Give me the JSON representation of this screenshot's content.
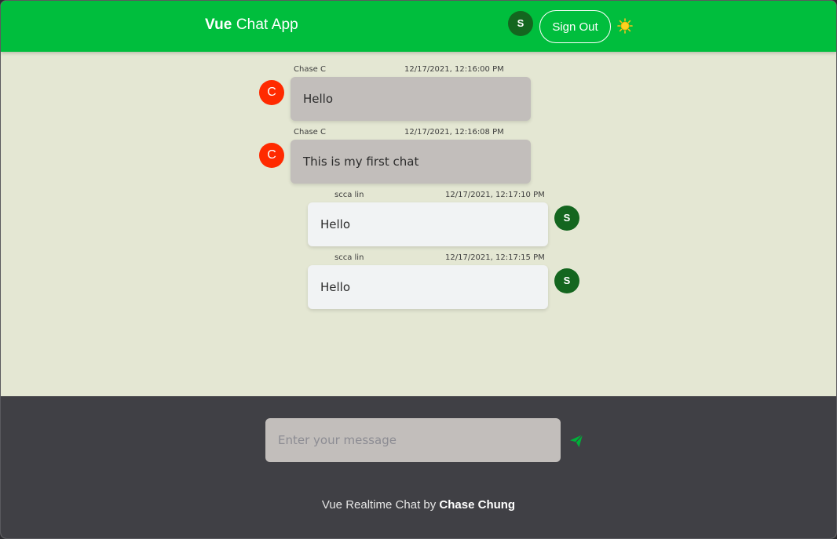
{
  "header": {
    "brand_strong": "Vue",
    "brand_rest": " Chat App",
    "avatar_initial": "S",
    "signout_label": "Sign Out",
    "theme_icon": "sun-icon",
    "accent_color": "#00be3d"
  },
  "messages": [
    {
      "name": "Chase C",
      "time": "12/17/2021, 12:16:00 PM",
      "text": "Hello",
      "initial": "C",
      "side": "other"
    },
    {
      "name": "Chase C",
      "time": "12/17/2021, 12:16:08 PM",
      "text": "This is my first chat",
      "initial": "C",
      "side": "other"
    },
    {
      "name": "scca lin",
      "time": "12/17/2021, 12:17:10 PM",
      "text": "Hello",
      "initial": "S",
      "side": "self"
    },
    {
      "name": "scca lin",
      "time": "12/17/2021, 12:17:15 PM",
      "text": "Hello",
      "initial": "S",
      "side": "self"
    }
  ],
  "composer": {
    "placeholder": "Enter your message",
    "value": "",
    "send_icon": "send-icon"
  },
  "footer": {
    "credits_prefix": "Vue Realtime Chat by ",
    "credits_author": "Chase Chung"
  }
}
